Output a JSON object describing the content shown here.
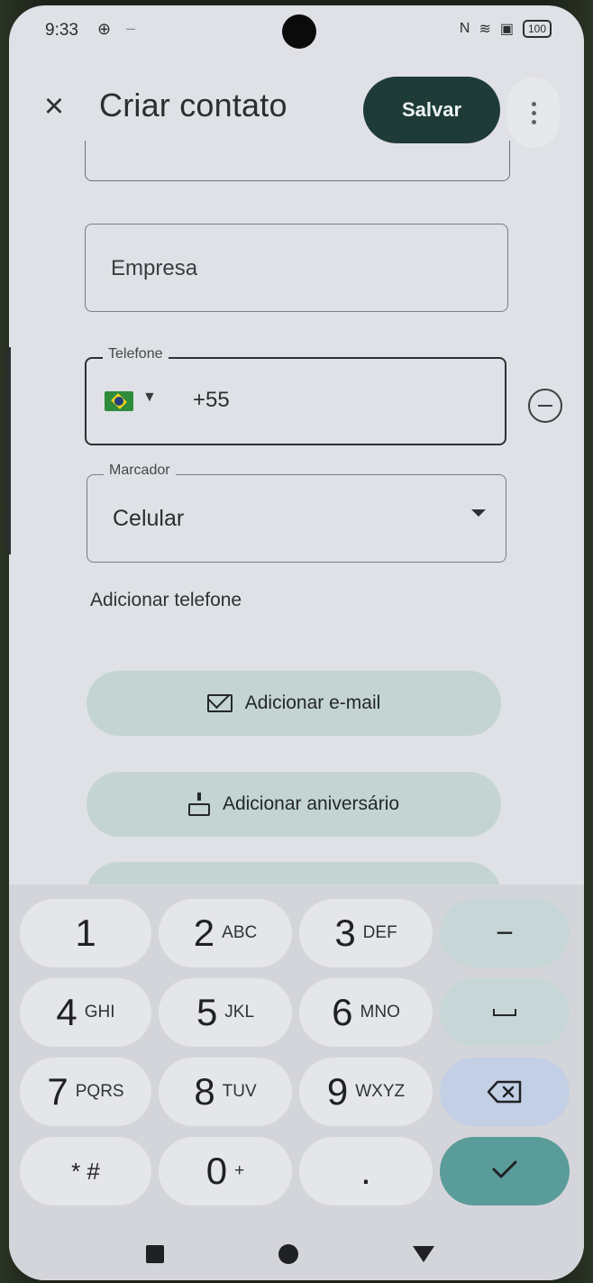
{
  "status_bar": {
    "time": "9:33",
    "battery": "100"
  },
  "app_bar": {
    "title": "Criar contato",
    "save_label": "Salvar"
  },
  "form": {
    "company_placeholder": "Empresa",
    "phone_label": "Telefone",
    "phone_value": "+55",
    "country_flag": "flag-brazil",
    "label_field_label": "Marcador",
    "label_field_value": "Celular",
    "add_phone": "Adicionar telefone",
    "add_email": "Adicionar e-mail",
    "add_birthday": "Adicionar aniversário"
  },
  "keypad": {
    "rows": [
      [
        {
          "d": "1",
          "l": ""
        },
        {
          "d": "2",
          "l": "ABC"
        },
        {
          "d": "3",
          "l": "DEF"
        },
        {
          "d": "−",
          "l": ""
        }
      ],
      [
        {
          "d": "4",
          "l": "GHI"
        },
        {
          "d": "5",
          "l": "JKL"
        },
        {
          "d": "6",
          "l": "MNO"
        },
        {
          "d": "",
          "l": ""
        }
      ],
      [
        {
          "d": "7",
          "l": "PQRS"
        },
        {
          "d": "8",
          "l": "TUV"
        },
        {
          "d": "9",
          "l": "WXYZ"
        },
        {
          "d": "",
          "l": ""
        }
      ],
      [
        {
          "d": "* #",
          "l": ""
        },
        {
          "d": "0",
          "l": "+"
        },
        {
          "d": ".",
          "l": ""
        },
        {
          "d": "",
          "l": ""
        }
      ]
    ]
  },
  "colors": {
    "save_bg": "#1f3b38",
    "pill_bg": "#c3d4d3",
    "done_key": "#5a9c9a",
    "backspace_key": "#c2cfe5"
  }
}
